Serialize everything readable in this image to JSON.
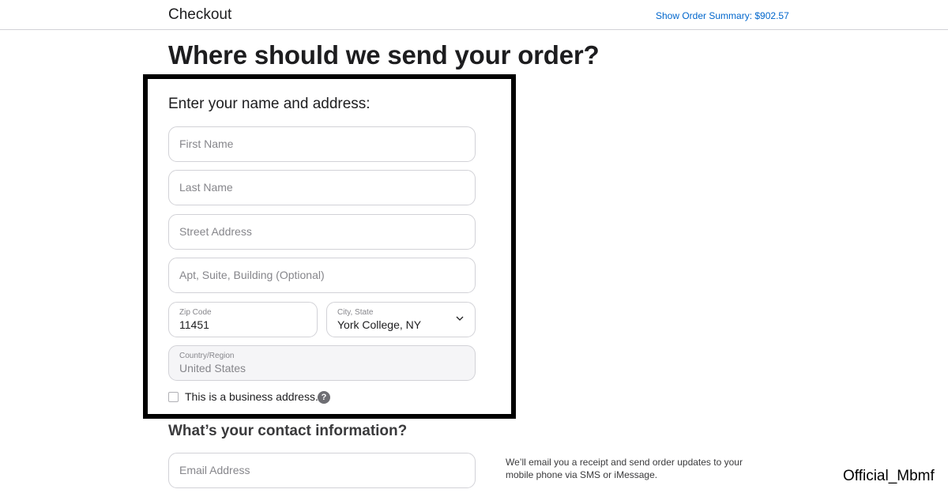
{
  "header": {
    "title": "Checkout",
    "order_summary": "Show Order Summary: $902.57"
  },
  "main": {
    "heading": "Where should we send your order?"
  },
  "address_section": {
    "heading": "Enter your name and address:",
    "first_name": {
      "placeholder": "First Name"
    },
    "last_name": {
      "placeholder": "Last Name"
    },
    "street_address": {
      "placeholder": "Street Address"
    },
    "apt": {
      "placeholder": "Apt, Suite, Building (Optional)"
    },
    "zip": {
      "label": "Zip Code",
      "value": "11451"
    },
    "city_state": {
      "label": "City, State",
      "value": "York College, NY"
    },
    "country": {
      "label": "Country/Region",
      "value": "United States"
    },
    "business_checkbox": {
      "label": "This is a business address.",
      "checked": false
    },
    "help_icon": "?"
  },
  "contact_section": {
    "heading": "What’s your contact information?",
    "email": {
      "placeholder": "Email Address"
    },
    "note": "We’ll email you a receipt and send order updates to your mobile phone via SMS or iMessage."
  },
  "watermark": "Official_Mbmf",
  "colors": {
    "link": "#0066cc",
    "text": "#1d1d1f",
    "border": "#d2d2d7",
    "highlight_box": "#000000"
  }
}
